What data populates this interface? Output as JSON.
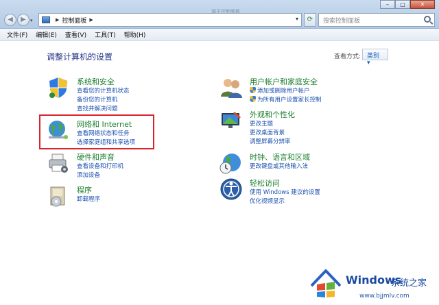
{
  "window": {
    "faint_title": "源于控制面板",
    "buttons": {
      "minimize": "–",
      "maximize": "□",
      "close": "✕"
    }
  },
  "address_bar": {
    "path": "控制面板",
    "search_placeholder": "搜索控制面板"
  },
  "menu": [
    "文件(F)",
    "编辑(E)",
    "查看(V)",
    "工具(T)",
    "帮助(H)"
  ],
  "content": {
    "heading": "调整计算机的设置",
    "view_by_label": "查看方式:",
    "view_by_value": "类别 ▾"
  },
  "categories_left": [
    {
      "title": "系统和安全",
      "icon": "shield-icon",
      "links": [
        "查看您的计算机状态",
        "备份您的计算机",
        "查找并解决问题"
      ]
    },
    {
      "title": "网络和 Internet",
      "icon": "network-globe-icon",
      "links": [
        "查看网络状态和任务",
        "选择家庭组和共享选项"
      ]
    },
    {
      "title": "硬件和声音",
      "icon": "printer-icon",
      "links": [
        "查看设备和打印机",
        "添加设备"
      ]
    },
    {
      "title": "程序",
      "icon": "programs-icon",
      "links": [
        "卸载程序"
      ]
    }
  ],
  "categories_right": [
    {
      "title": "用户帐户和家庭安全",
      "icon": "users-icon",
      "links": [
        "添加或删除用户帐户",
        "为所有用户设置家长控制"
      ]
    },
    {
      "title": "外观和个性化",
      "icon": "monitor-icon",
      "links": [
        "更改主题",
        "更改桌面背景",
        "调整屏幕分辨率"
      ]
    },
    {
      "title": "时钟、语言和区域",
      "icon": "clock-globe-icon",
      "links": [
        "更改键盘或其他输入法"
      ]
    },
    {
      "title": "轻松访问",
      "icon": "accessibility-icon",
      "links": [
        "使用 Windows 建议的设置",
        "优化视频显示"
      ]
    }
  ],
  "watermark": {
    "brand": "Windows",
    "sub": "系统之家",
    "url": "www.bjjmlv.com"
  },
  "colors": {
    "title_green": "#1a7e2e",
    "link_blue": "#1a4fb0",
    "heading_blue": "#1e3287",
    "highlight_red": "#d9232c"
  }
}
